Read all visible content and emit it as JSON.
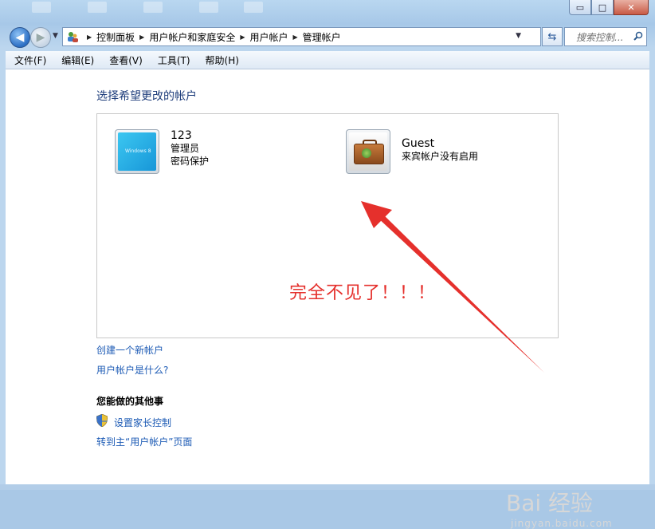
{
  "window": {
    "buttons": {
      "minimize": "▭",
      "maximize": "□",
      "close": "✕"
    }
  },
  "nav": {
    "back_icon": "left-arrow-icon",
    "forward_icon": "right-arrow-icon",
    "breadcrumb": [
      "控制面板",
      "用户帐户和家庭安全",
      "用户帐户",
      "管理帐户"
    ],
    "search_placeholder": "搜索控制..."
  },
  "menubar": [
    "文件(F)",
    "编辑(E)",
    "查看(V)",
    "工具(T)",
    "帮助(H)"
  ],
  "main": {
    "heading": "选择希望更改的帐户",
    "accounts": [
      {
        "name": "123",
        "lines": [
          "管理员",
          "密码保护"
        ],
        "tile_text": "Windows 8"
      },
      {
        "name": "Guest",
        "lines": [
          "来宾帐户没有启用"
        ]
      }
    ],
    "annotation": "完全不见了！！！",
    "links": {
      "create": "创建一个新帐户",
      "what_is": "用户帐户是什么?"
    },
    "other": {
      "title": "您能做的其他事",
      "parental": "设置家长控制",
      "goto_main": "转到主“用户帐户”页面"
    }
  },
  "watermark": {
    "brand": "Bai 经验",
    "url": "jingyan.baidu.com"
  },
  "colors": {
    "annotation": "#e5302c",
    "link": "#1d5bb5",
    "heading": "#1e3d7b"
  }
}
